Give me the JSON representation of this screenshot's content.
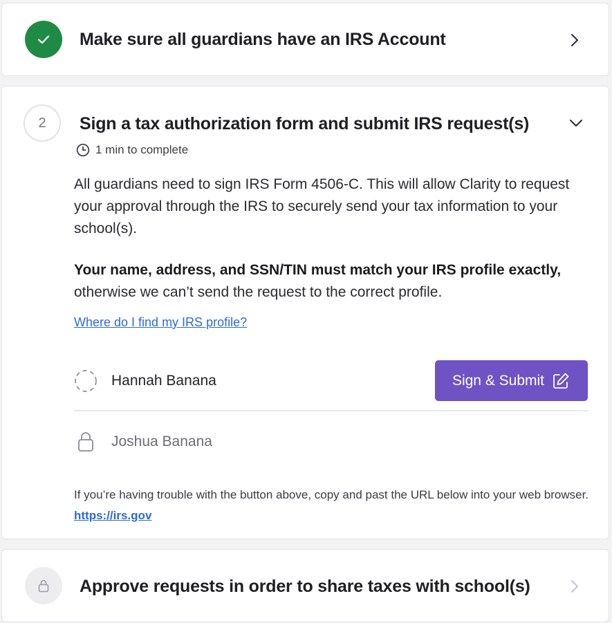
{
  "steps": [
    {
      "status": "done",
      "title": "Make sure all guardians have an IRS Account"
    },
    {
      "status": "active",
      "number": "2",
      "title": "Sign a tax authorization form and submit IRS request(s)",
      "time": "1 min to complete",
      "paragraph1": "All guardians need to sign IRS Form 4506-C. This will allow Clarity to request your approval through the IRS to securely send your tax information to your school(s).",
      "paragraph2_bold": "Your name, address, and SSN/TIN must match your IRS profile exactly,",
      "paragraph2_rest": " otherwise we can’t send the request to the correct profile.",
      "help_link": "Where do I find my IRS profile?",
      "guardians": [
        {
          "name": "Hannah Banana",
          "state": "pending",
          "icon": "dashed-circle-icon"
        },
        {
          "name": "Joshua Banana",
          "state": "locked",
          "icon": "lock-icon"
        }
      ],
      "sign_button_label": "Sign & Submit",
      "trouble_text": "If you’re having trouble with the button above, copy and past the URL below into your web browser. ",
      "trouble_url": "https://irs.gov"
    },
    {
      "status": "locked",
      "title": "Approve requests in order to share taxes with school(s)"
    }
  ],
  "colors": {
    "done_green": "#1f8a45",
    "primary_purple": "#6f52c4",
    "link_blue": "#2d6ad8"
  }
}
